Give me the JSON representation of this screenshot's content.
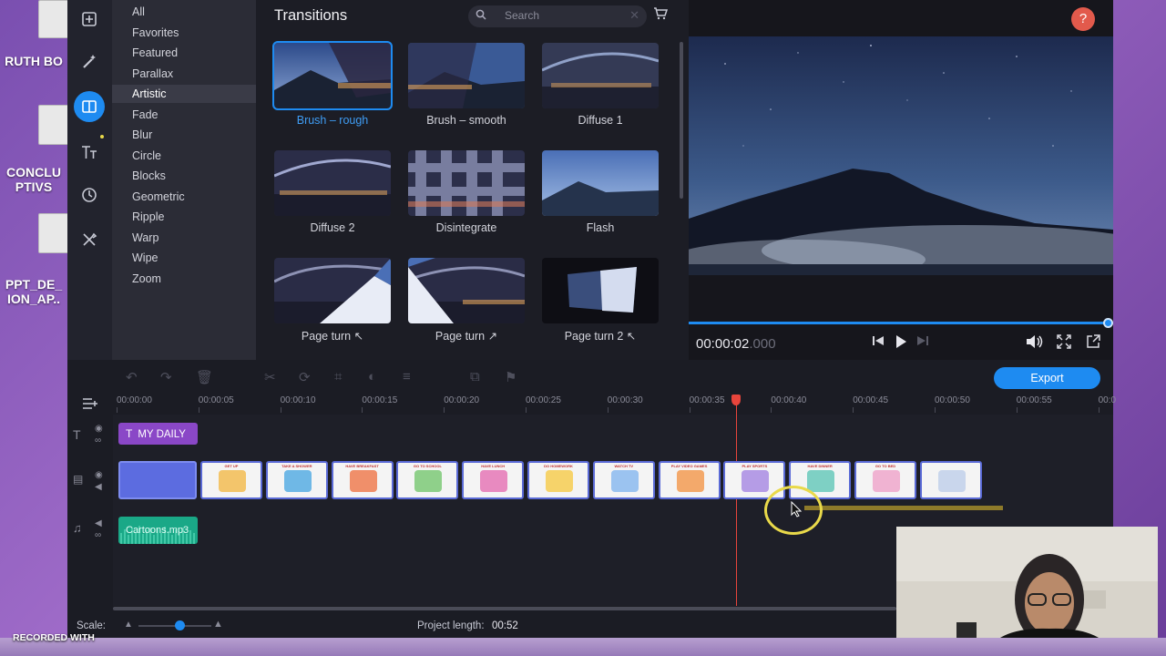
{
  "desktop": {
    "items": [
      {
        "label": "RUTH BO"
      },
      {
        "label": "CONCLU PTIVS"
      },
      {
        "label": "PPT_DE_ ION_AP.."
      }
    ],
    "recorded_with": "RECORDED WITH"
  },
  "sidebar_tools": [
    {
      "icon": "add-media-icon"
    },
    {
      "icon": "filters-icon"
    },
    {
      "icon": "transitions-icon"
    },
    {
      "icon": "titles-icon"
    },
    {
      "icon": "stickers-icon"
    },
    {
      "icon": "more-tools-icon"
    }
  ],
  "categories": [
    "All",
    "Favorites",
    "Featured",
    "Parallax",
    "Artistic",
    "Fade",
    "Blur",
    "Circle",
    "Blocks",
    "Geometric",
    "Ripple",
    "Warp",
    "Wipe",
    "Zoom"
  ],
  "active_category": "Artistic",
  "transitions_panel": {
    "title": "Transitions",
    "search_placeholder": "Search",
    "items": [
      {
        "label": "Brush – rough",
        "selected": true
      },
      {
        "label": "Brush – smooth"
      },
      {
        "label": "Diffuse 1"
      },
      {
        "label": "Diffuse 2"
      },
      {
        "label": "Disintegrate"
      },
      {
        "label": "Flash"
      },
      {
        "label": "Page turn ↖"
      },
      {
        "label": "Page turn ↗"
      },
      {
        "label": "Page turn 2 ↖"
      }
    ]
  },
  "player": {
    "time_main": "00:00:02",
    "time_ms": ".000",
    "help": "?",
    "progress": 1.0
  },
  "timeline": {
    "export_label": "Export",
    "ruler_ticks": [
      "00:00:00",
      "00:00:05",
      "00:00:10",
      "00:00:15",
      "00:00:20",
      "00:00:25",
      "00:00:30",
      "00:00:35",
      "00:00:40",
      "00:00:45",
      "00:00:50",
      "00:00:55",
      "00:0"
    ],
    "title_clip": "MY DAILY",
    "video_clips": [
      "GET UP",
      "TAKE A SHOWER",
      "HAVE BREAKFAST",
      "GO TO SCHOOL",
      "HAVE LUNCH",
      "DO HOMEWORK",
      "WATCH TV",
      "PLAY VIDEO GAMES",
      "PLAY SPORTS",
      "HAVE DINNER",
      "GO TO BED",
      ""
    ],
    "audio_clip": "Cartoons.mp3",
    "scale_label": "Scale:",
    "project_length_label": "Project length:",
    "project_length": "00:52"
  },
  "colors": {
    "accent": "#1e8bf1",
    "title_clip": "#8a47c7",
    "audio_clip": "#1aa887",
    "playhead": "#e8453c"
  }
}
